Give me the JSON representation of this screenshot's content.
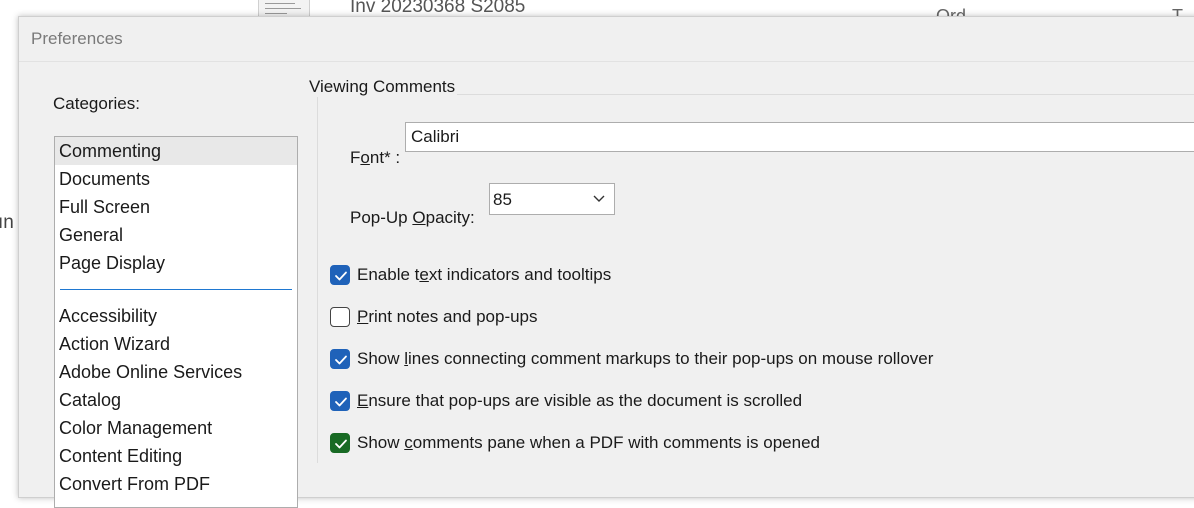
{
  "background": {
    "document_title": "Inv 20230368 S2085",
    "right_fragment_1": "Ord",
    "right_fragment_2": "T",
    "left_fragment": "ın"
  },
  "dialog": {
    "title": "Preferences",
    "categories_label": "Categories:",
    "categories_top": [
      "Commenting",
      "Documents",
      "Full Screen",
      "General",
      "Page Display"
    ],
    "categories_rest": [
      "Accessibility",
      "Action Wizard",
      "Adobe Online Services",
      "Catalog",
      "Color Management",
      "Content Editing",
      "Convert From PDF"
    ],
    "selected_category": "Commenting",
    "section_title": "Viewing Comments",
    "font": {
      "label_prefix": "F",
      "label_underlined": "o",
      "label_suffix": "nt* :",
      "value": "Calibri"
    },
    "opacity": {
      "label_prefix": "Pop-Up ",
      "label_underlined": "O",
      "label_suffix": "pacity:",
      "value": "85"
    },
    "checkboxes": [
      {
        "pre": "Enable t",
        "u": "e",
        "post": "xt indicators and tooltips",
        "checked": true
      },
      {
        "pre": "",
        "u": "P",
        "post": "rint notes and pop-ups",
        "checked": false
      },
      {
        "pre": "Show ",
        "u": "l",
        "post": "ines connecting comment markups to their pop-ups on mouse rollover",
        "checked": true
      },
      {
        "pre": "",
        "u": "E",
        "post": "nsure that pop-ups are visible as the document is scrolled",
        "checked": true
      },
      {
        "pre": "Show ",
        "u": "c",
        "post": "omments pane when a PDF with comments is opened",
        "checked": true
      }
    ]
  },
  "colors": {
    "checkbox_checked": "#1f62b9",
    "checkbox_highlighted": "#186a24",
    "highlight": "#ede700",
    "list_separator": "#1f78d1"
  },
  "icons": {
    "checkmark": "check-icon",
    "dropdown": "chevron-down-icon"
  }
}
